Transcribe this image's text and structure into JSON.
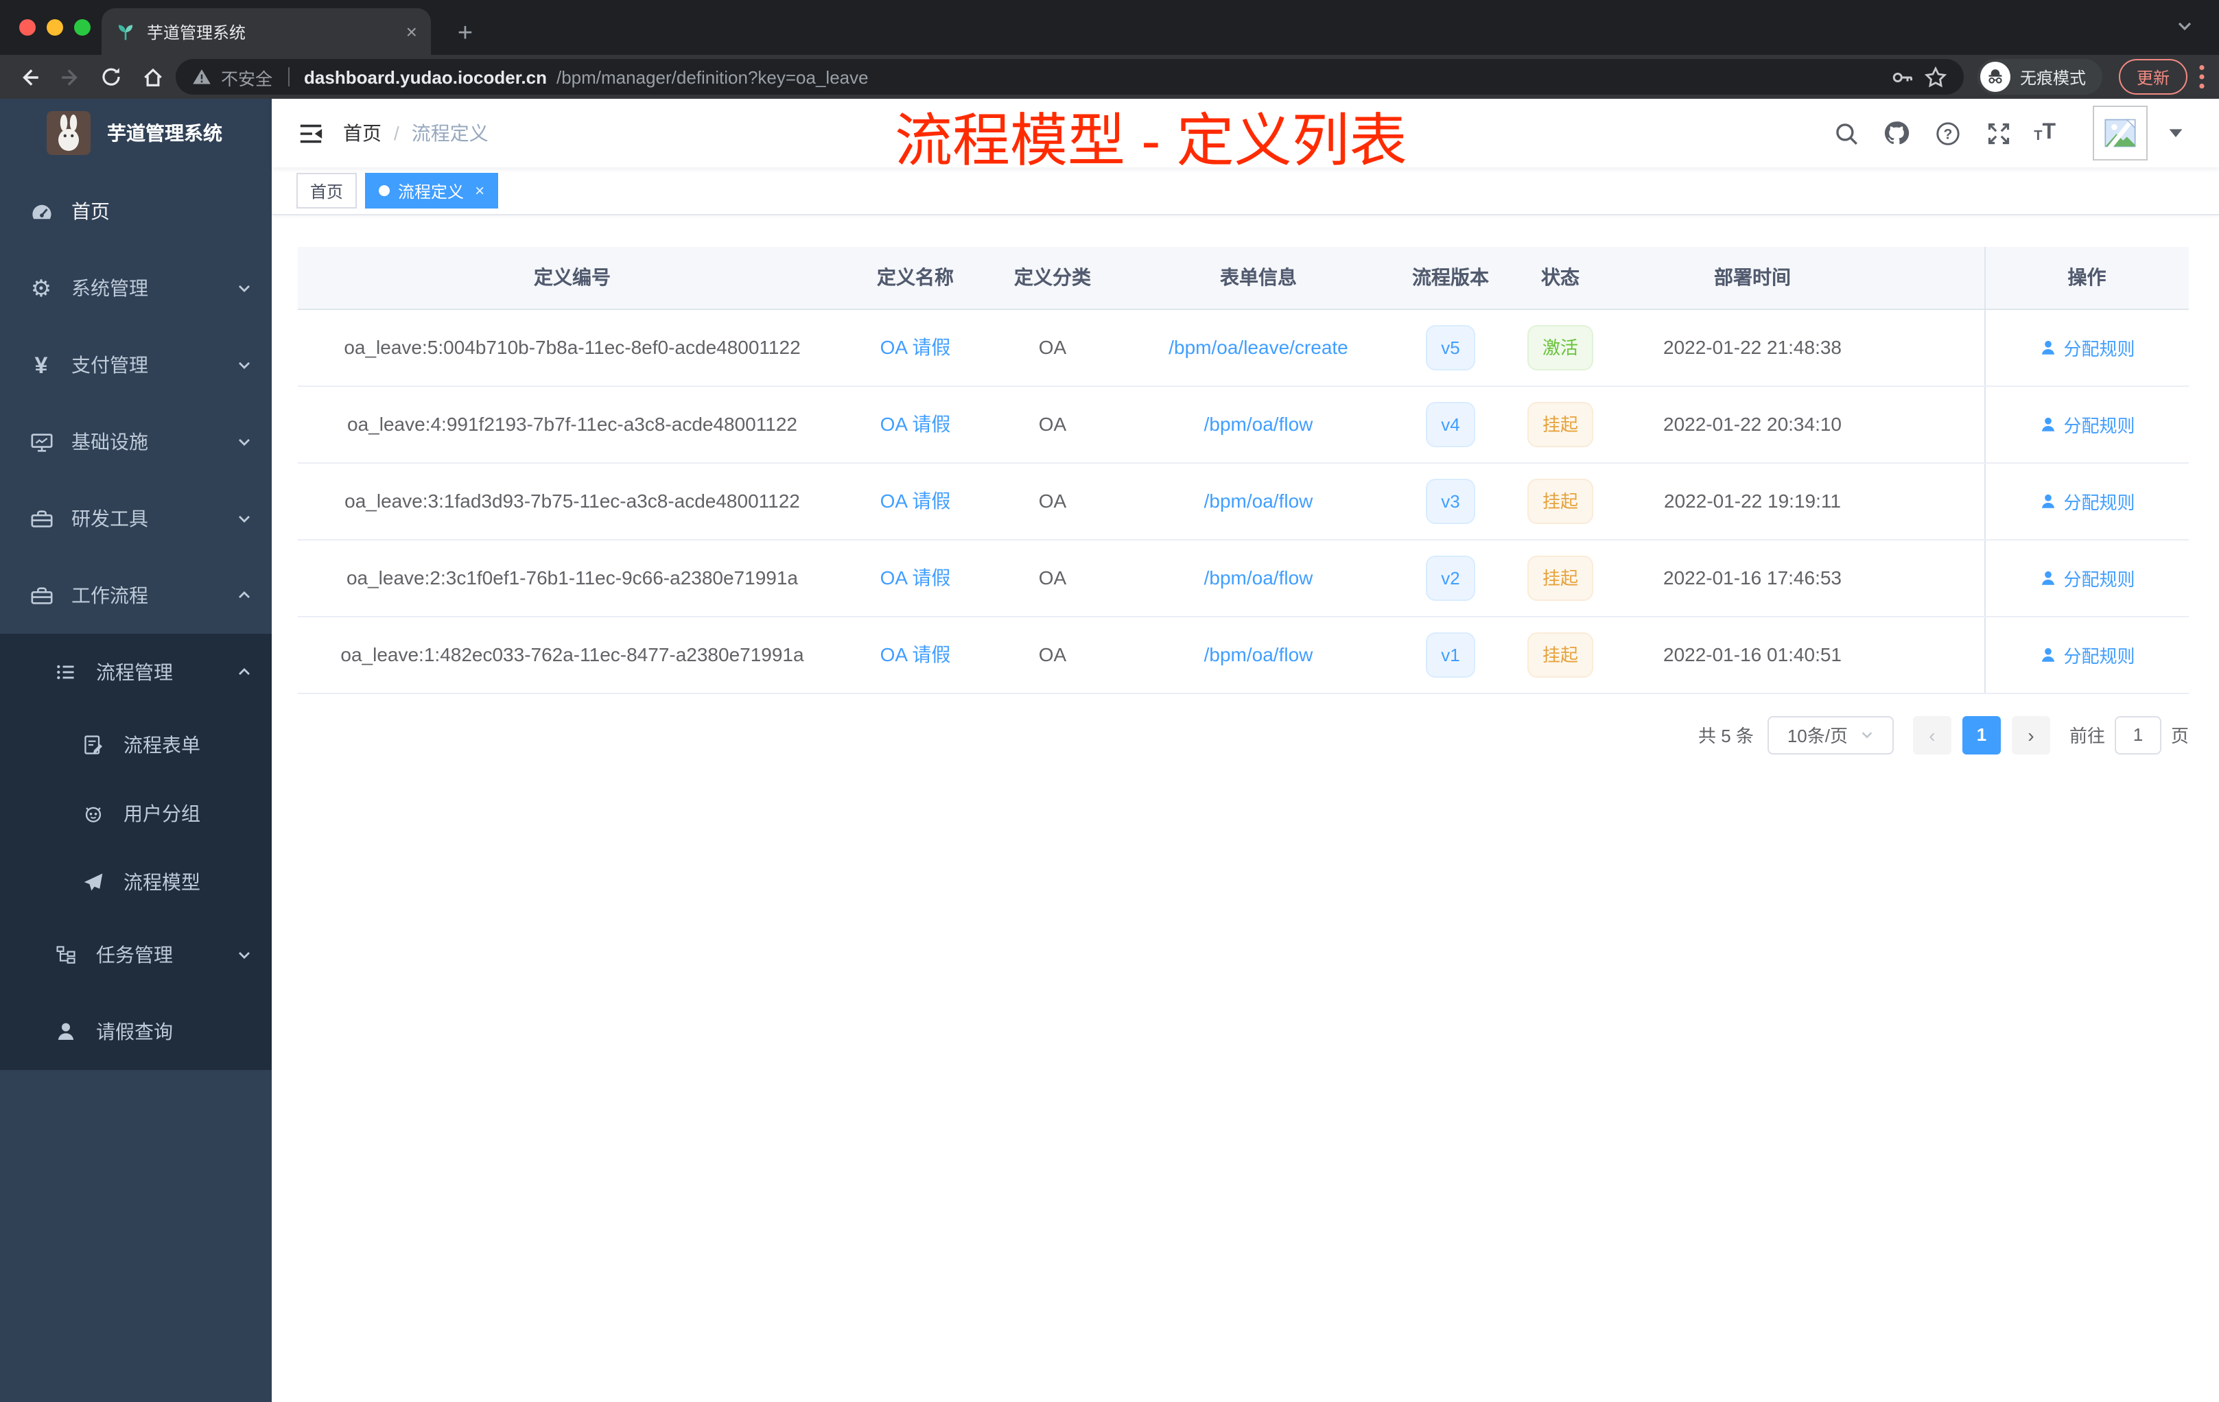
{
  "colors": {
    "accent": "#409eff",
    "overlay_title": "#ff2b00",
    "sidebar_bg": "#304156",
    "submenu_bg": "#1f2d3d",
    "status_active": "#67c23a",
    "status_suspended": "#e6a23c",
    "update_badge": "#f28b82"
  },
  "browser": {
    "tab": {
      "title": "芋道管理系统",
      "close": "×",
      "new_tab": "+"
    },
    "address_bar": {
      "security_label": "不安全",
      "url_host": "dashboard.yudao.iocoder.cn",
      "url_path": "/bpm/manager/definition?key=oa_leave"
    },
    "incognito_label": "无痕模式",
    "update_label": "更新"
  },
  "icons": {
    "gear_glyph": "⚙",
    "yen_glyph": "¥"
  },
  "sidebar": {
    "app_title": "芋道管理系统",
    "menu": [
      {
        "label": "首页"
      },
      {
        "label": "系统管理"
      },
      {
        "label": "支付管理"
      },
      {
        "label": "基础设施"
      },
      {
        "label": "研发工具"
      },
      {
        "label": "工作流程"
      },
      {
        "label": "流程管理"
      },
      {
        "label": "流程表单"
      },
      {
        "label": "用户分组"
      },
      {
        "label": "流程模型"
      },
      {
        "label": "任务管理"
      },
      {
        "label": "请假查询"
      }
    ]
  },
  "header": {
    "breadcrumb": {
      "root": "首页",
      "separator": "/",
      "current": "流程定义"
    },
    "overlay_title": "流程模型 - 定义列表"
  },
  "tags": {
    "home": "首页",
    "active": "流程定义",
    "close": "×"
  },
  "table": {
    "columns": [
      "定义编号",
      "定义名称",
      "定义分类",
      "表单信息",
      "流程版本",
      "状态",
      "部署时间",
      "操作"
    ],
    "rows": [
      {
        "id": "oa_leave:5:004b710b-7b8a-11ec-8ef0-acde48001122",
        "name": "OA 请假",
        "category": "OA",
        "form": "/bpm/oa/leave/create",
        "version": "v5",
        "status": "激活",
        "status_type": "success",
        "deployed_at": "2022-01-22 21:48:38",
        "action": "分配规则"
      },
      {
        "id": "oa_leave:4:991f2193-7b7f-11ec-a3c8-acde48001122",
        "name": "OA 请假",
        "category": "OA",
        "form": "/bpm/oa/flow",
        "version": "v4",
        "status": "挂起",
        "status_type": "warning",
        "deployed_at": "2022-01-22 20:34:10",
        "action": "分配规则"
      },
      {
        "id": "oa_leave:3:1fad3d93-7b75-11ec-a3c8-acde48001122",
        "name": "OA 请假",
        "category": "OA",
        "form": "/bpm/oa/flow",
        "version": "v3",
        "status": "挂起",
        "status_type": "warning",
        "deployed_at": "2022-01-22 19:19:11",
        "action": "分配规则"
      },
      {
        "id": "oa_leave:2:3c1f0ef1-76b1-11ec-9c66-a2380e71991a",
        "name": "OA 请假",
        "category": "OA",
        "form": "/bpm/oa/flow",
        "version": "v2",
        "status": "挂起",
        "status_type": "warning",
        "deployed_at": "2022-01-16 17:46:53",
        "action": "分配规则"
      },
      {
        "id": "oa_leave:1:482ec033-762a-11ec-8477-a2380e71991a",
        "name": "OA 请假",
        "category": "OA",
        "form": "/bpm/oa/flow",
        "version": "v1",
        "status": "挂起",
        "status_type": "warning",
        "deployed_at": "2022-01-16 01:40:51",
        "action": "分配规则"
      }
    ]
  },
  "pagination": {
    "total": "共 5 条",
    "page_size": "10条/页",
    "prev": "‹",
    "next": "›",
    "current_page": "1",
    "goto_label": "前往",
    "goto_value": "1",
    "page_unit": "页"
  }
}
